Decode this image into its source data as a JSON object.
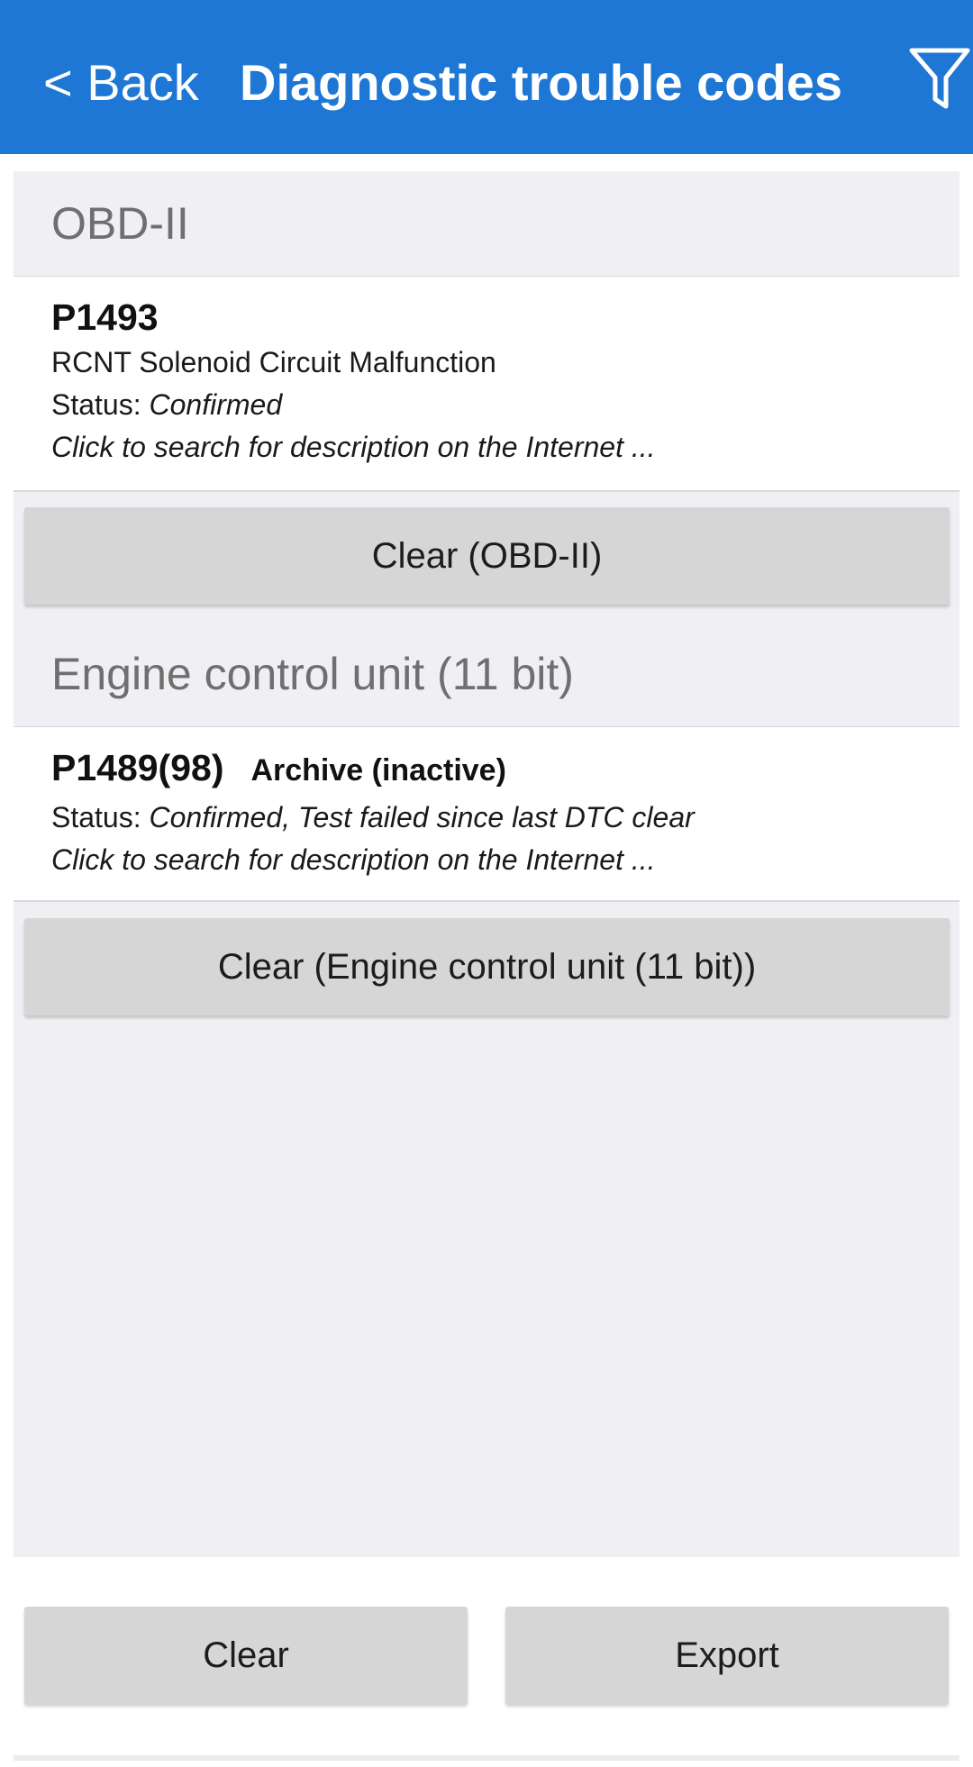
{
  "header": {
    "back_label": "< Back",
    "title": "Diagnostic trouble codes",
    "filter_icon": "filter-icon",
    "bg_color": "#1e77d4"
  },
  "sections": [
    {
      "title": "OBD-II",
      "items": [
        {
          "code": "P1493",
          "description": "RCNT Solenoid Circuit Malfunction",
          "status_label": "Status: ",
          "status_value": "Confirmed",
          "search_hint": "Click to search for description on the Internet ..."
        }
      ],
      "clear_label": "Clear (OBD-II)"
    },
    {
      "title": "Engine control unit (11 bit)",
      "items": [
        {
          "code": "P1489(98)",
          "tag": "Archive (inactive)",
          "status_label": "Status: ",
          "status_value": "Confirmed, Test failed since last DTC clear",
          "search_hint": "Click to search for description on the Internet ..."
        }
      ],
      "clear_label": "Clear (Engine control unit (11 bit))"
    }
  ],
  "footer": {
    "clear_label": "Clear",
    "export_label": "Export"
  }
}
